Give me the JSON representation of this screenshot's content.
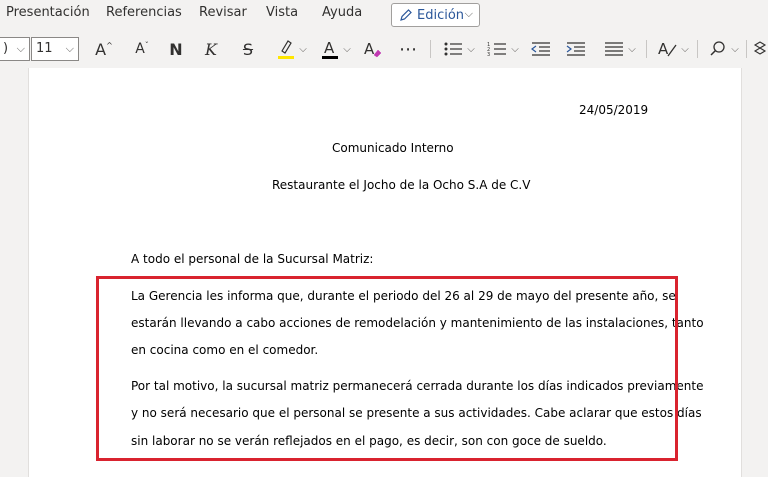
{
  "menu": {
    "items": [
      "Presentación",
      "Referencias",
      "Revisar",
      "Vista",
      "Ayuda"
    ],
    "mode_button": "Edición"
  },
  "toolbar": {
    "font_name_partial": ")",
    "font_size": "11",
    "icons": [
      "grow-font-icon",
      "shrink-font-icon",
      "bold-icon",
      "italic-icon",
      "strikethrough-icon",
      "highlight-icon",
      "font-color-icon",
      "clear-format-icon",
      "more-icon",
      "bullets-icon",
      "numbering-icon",
      "decrease-indent-icon",
      "increase-indent-icon",
      "align-icon",
      "styles-icon",
      "find-icon"
    ],
    "highlight_color": "#ffe600",
    "font_color": "#000000"
  },
  "document": {
    "date": "24/05/2019",
    "title": "Comunicado Interno",
    "company": "Restaurante el Jocho de la Ocho S.A de C.V",
    "greeting": "A todo el personal de la Sucursal Matriz:",
    "p1": [
      "La Gerencia les informa que, durante el periodo del 26 al 29 de mayo del presente año, se",
      "estarán llevando a cabo acciones de remodelación y mantenimiento de las instalaciones, tanto",
      "en cocina como en el comedor."
    ],
    "p2": [
      "Por tal motivo, la sucursal matriz permanecerá cerrada durante los días indicados previamente",
      "y no será necesario que el personal se presente a sus actividades. Cabe aclarar que estos días",
      "sin laborar no se verán reflejados en el pago, es decir, son con goce de sueldo."
    ]
  },
  "colors": {
    "accent": "#2b579a",
    "annotation": "#d9232f"
  }
}
